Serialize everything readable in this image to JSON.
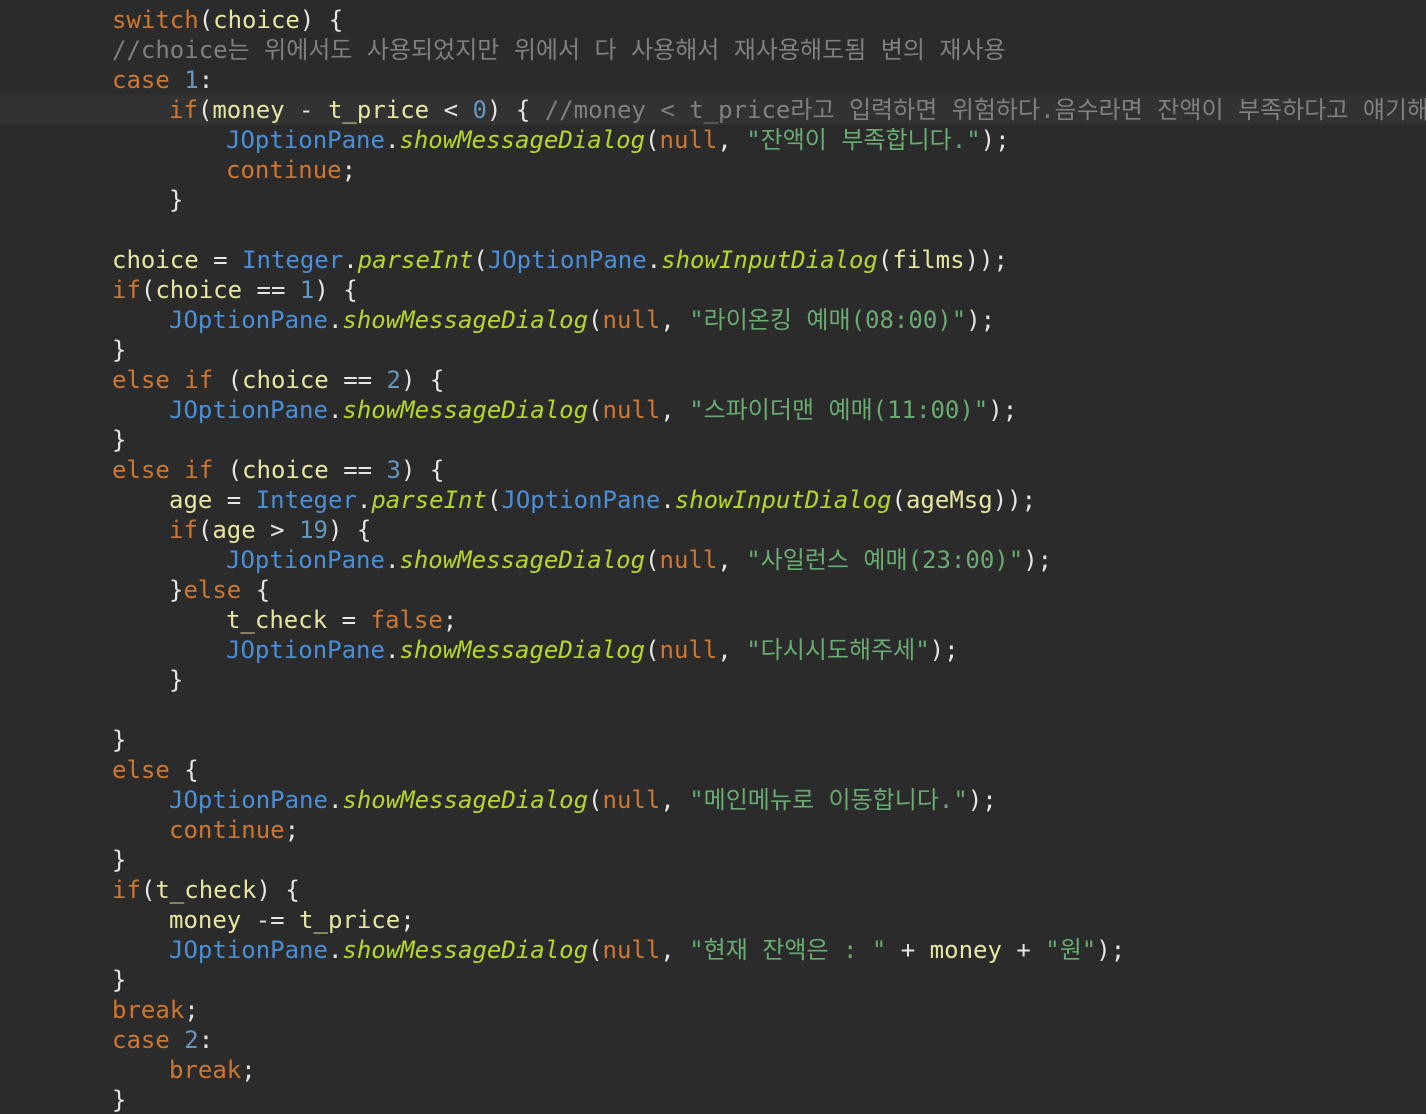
{
  "colors": {
    "background": "#2b2b2b",
    "current_line": "#323232",
    "keyword": "#cc7832",
    "number": "#6897bb",
    "comment": "#808080",
    "string": "#6aab73",
    "class": "#4a8fd8",
    "method": "#b4d82a",
    "variable": "#e8e6a3",
    "plain": "#e8e6e3"
  },
  "lines": [
    {
      "indent": 2,
      "tokens": [
        [
          "keyword",
          "switch"
        ],
        [
          "op",
          "("
        ],
        [
          "var",
          "choice"
        ],
        [
          "op",
          ") {"
        ]
      ]
    },
    {
      "indent": 2,
      "tokens": [
        [
          "comment",
          "//choice는 위에서도 사용되었지만 위에서 다 사용해서 재사용해도됨 변의 재사용"
        ]
      ]
    },
    {
      "indent": 2,
      "tokens": [
        [
          "keyword",
          "case "
        ],
        [
          "number",
          "1"
        ],
        [
          "op",
          ":"
        ]
      ]
    },
    {
      "indent": 3,
      "tokens": [
        [
          "keyword",
          "if"
        ],
        [
          "op",
          "("
        ],
        [
          "var",
          "money"
        ],
        [
          "op",
          " - "
        ],
        [
          "var",
          "t_price"
        ],
        [
          "op",
          " < "
        ],
        [
          "number",
          "0"
        ],
        [
          "op",
          ") { "
        ],
        [
          "comment",
          "//money < t_price라고 입력하면 위험하다.음수라면 잔액이 부족하다고 얘기해야함"
        ]
      ]
    },
    {
      "indent": 4,
      "tokens": [
        [
          "class",
          "JOptionPane"
        ],
        [
          "op",
          "."
        ],
        [
          "method",
          "showMessageDialog"
        ],
        [
          "op",
          "("
        ],
        [
          "keyword",
          "null"
        ],
        [
          "op",
          ", "
        ],
        [
          "string",
          "\"잔액이 부족합니다.\""
        ],
        [
          "op",
          ");"
        ]
      ]
    },
    {
      "indent": 4,
      "tokens": [
        [
          "keyword",
          "continue"
        ],
        [
          "op",
          ";"
        ]
      ]
    },
    {
      "indent": 3,
      "tokens": [
        [
          "op",
          "}"
        ]
      ]
    },
    {
      "indent": 0,
      "tokens": []
    },
    {
      "indent": 2,
      "tokens": [
        [
          "var",
          "choice"
        ],
        [
          "op",
          " = "
        ],
        [
          "class",
          "Integer"
        ],
        [
          "op",
          "."
        ],
        [
          "method",
          "parseInt"
        ],
        [
          "op",
          "("
        ],
        [
          "class",
          "JOptionPane"
        ],
        [
          "op",
          "."
        ],
        [
          "method",
          "showInputDialog"
        ],
        [
          "op",
          "("
        ],
        [
          "var",
          "films"
        ],
        [
          "op",
          "));"
        ]
      ]
    },
    {
      "indent": 2,
      "tokens": [
        [
          "keyword",
          "if"
        ],
        [
          "op",
          "("
        ],
        [
          "var",
          "choice"
        ],
        [
          "op",
          " == "
        ],
        [
          "number",
          "1"
        ],
        [
          "op",
          ") {"
        ]
      ]
    },
    {
      "indent": 3,
      "tokens": [
        [
          "class",
          "JOptionPane"
        ],
        [
          "op",
          "."
        ],
        [
          "method",
          "showMessageDialog"
        ],
        [
          "op",
          "("
        ],
        [
          "keyword",
          "null"
        ],
        [
          "op",
          ", "
        ],
        [
          "string",
          "\"라이온킹 예매(08:00)\""
        ],
        [
          "op",
          ");"
        ]
      ]
    },
    {
      "indent": 2,
      "tokens": [
        [
          "op",
          "}"
        ]
      ]
    },
    {
      "indent": 2,
      "tokens": [
        [
          "keyword",
          "else if "
        ],
        [
          "op",
          "("
        ],
        [
          "var",
          "choice"
        ],
        [
          "op",
          " == "
        ],
        [
          "number",
          "2"
        ],
        [
          "op",
          ") {"
        ]
      ]
    },
    {
      "indent": 3,
      "tokens": [
        [
          "class",
          "JOptionPane"
        ],
        [
          "op",
          "."
        ],
        [
          "method",
          "showMessageDialog"
        ],
        [
          "op",
          "("
        ],
        [
          "keyword",
          "null"
        ],
        [
          "op",
          ", "
        ],
        [
          "string",
          "\"스파이더맨 예매(11:00)\""
        ],
        [
          "op",
          ");"
        ]
      ]
    },
    {
      "indent": 2,
      "tokens": [
        [
          "op",
          "}"
        ]
      ]
    },
    {
      "indent": 2,
      "tokens": [
        [
          "keyword",
          "else if "
        ],
        [
          "op",
          "("
        ],
        [
          "var",
          "choice"
        ],
        [
          "op",
          " == "
        ],
        [
          "number",
          "3"
        ],
        [
          "op",
          ") {"
        ]
      ]
    },
    {
      "indent": 3,
      "tokens": [
        [
          "var",
          "age"
        ],
        [
          "op",
          " = "
        ],
        [
          "class",
          "Integer"
        ],
        [
          "op",
          "."
        ],
        [
          "method",
          "parseInt"
        ],
        [
          "op",
          "("
        ],
        [
          "class",
          "JOptionPane"
        ],
        [
          "op",
          "."
        ],
        [
          "method",
          "showInputDialog"
        ],
        [
          "op",
          "("
        ],
        [
          "var",
          "ageMsg"
        ],
        [
          "op",
          "));"
        ]
      ]
    },
    {
      "indent": 3,
      "tokens": [
        [
          "keyword",
          "if"
        ],
        [
          "op",
          "("
        ],
        [
          "var",
          "age"
        ],
        [
          "op",
          " > "
        ],
        [
          "number",
          "19"
        ],
        [
          "op",
          ") {"
        ]
      ]
    },
    {
      "indent": 4,
      "tokens": [
        [
          "class",
          "JOptionPane"
        ],
        [
          "op",
          "."
        ],
        [
          "method",
          "showMessageDialog"
        ],
        [
          "op",
          "("
        ],
        [
          "keyword",
          "null"
        ],
        [
          "op",
          ", "
        ],
        [
          "string",
          "\"사일런스 예매(23:00)\""
        ],
        [
          "op",
          ");"
        ]
      ]
    },
    {
      "indent": 3,
      "tokens": [
        [
          "op",
          "}"
        ],
        [
          "keyword",
          "else"
        ],
        [
          "op",
          " {"
        ]
      ]
    },
    {
      "indent": 4,
      "tokens": [
        [
          "var",
          "t_check"
        ],
        [
          "op",
          " = "
        ],
        [
          "keyword",
          "false"
        ],
        [
          "op",
          ";"
        ]
      ]
    },
    {
      "indent": 4,
      "tokens": [
        [
          "class",
          "JOptionPane"
        ],
        [
          "op",
          "."
        ],
        [
          "method",
          "showMessageDialog"
        ],
        [
          "op",
          "("
        ],
        [
          "keyword",
          "null"
        ],
        [
          "op",
          ", "
        ],
        [
          "string",
          "\"다시시도해주세\""
        ],
        [
          "op",
          ");"
        ]
      ]
    },
    {
      "indent": 3,
      "tokens": [
        [
          "op",
          "}"
        ]
      ]
    },
    {
      "indent": 0,
      "tokens": []
    },
    {
      "indent": 2,
      "tokens": [
        [
          "op",
          "}"
        ]
      ]
    },
    {
      "indent": 2,
      "tokens": [
        [
          "keyword",
          "else"
        ],
        [
          "op",
          " {"
        ]
      ]
    },
    {
      "indent": 3,
      "tokens": [
        [
          "class",
          "JOptionPane"
        ],
        [
          "op",
          "."
        ],
        [
          "method",
          "showMessageDialog"
        ],
        [
          "op",
          "("
        ],
        [
          "keyword",
          "null"
        ],
        [
          "op",
          ", "
        ],
        [
          "string",
          "\"메인메뉴로 이동합니다.\""
        ],
        [
          "op",
          ");"
        ]
      ]
    },
    {
      "indent": 3,
      "tokens": [
        [
          "keyword",
          "continue"
        ],
        [
          "op",
          ";"
        ]
      ]
    },
    {
      "indent": 2,
      "tokens": [
        [
          "op",
          "}"
        ]
      ]
    },
    {
      "indent": 2,
      "tokens": [
        [
          "keyword",
          "if"
        ],
        [
          "op",
          "("
        ],
        [
          "var",
          "t_check"
        ],
        [
          "op",
          ") {"
        ]
      ]
    },
    {
      "indent": 3,
      "tokens": [
        [
          "var",
          "money"
        ],
        [
          "op",
          " -= "
        ],
        [
          "var",
          "t_price"
        ],
        [
          "op",
          ";"
        ]
      ]
    },
    {
      "indent": 3,
      "tokens": [
        [
          "class",
          "JOptionPane"
        ],
        [
          "op",
          "."
        ],
        [
          "method",
          "showMessageDialog"
        ],
        [
          "op",
          "("
        ],
        [
          "keyword",
          "null"
        ],
        [
          "op",
          ", "
        ],
        [
          "string",
          "\"현재 잔액은 : \""
        ],
        [
          "op",
          " + "
        ],
        [
          "var",
          "money"
        ],
        [
          "op",
          " + "
        ],
        [
          "string",
          "\"원\""
        ],
        [
          "op",
          ");"
        ]
      ]
    },
    {
      "indent": 2,
      "tokens": [
        [
          "op",
          "}"
        ]
      ]
    },
    {
      "indent": 2,
      "tokens": [
        [
          "keyword",
          "break"
        ],
        [
          "op",
          ";"
        ]
      ]
    },
    {
      "indent": 2,
      "tokens": [
        [
          "keyword",
          "case "
        ],
        [
          "number",
          "2"
        ],
        [
          "op",
          ":"
        ]
      ]
    },
    {
      "indent": 3,
      "tokens": [
        [
          "keyword",
          "break"
        ],
        [
          "op",
          ";"
        ]
      ]
    },
    {
      "indent": 2,
      "tokens": [
        [
          "op",
          "}"
        ]
      ]
    }
  ]
}
